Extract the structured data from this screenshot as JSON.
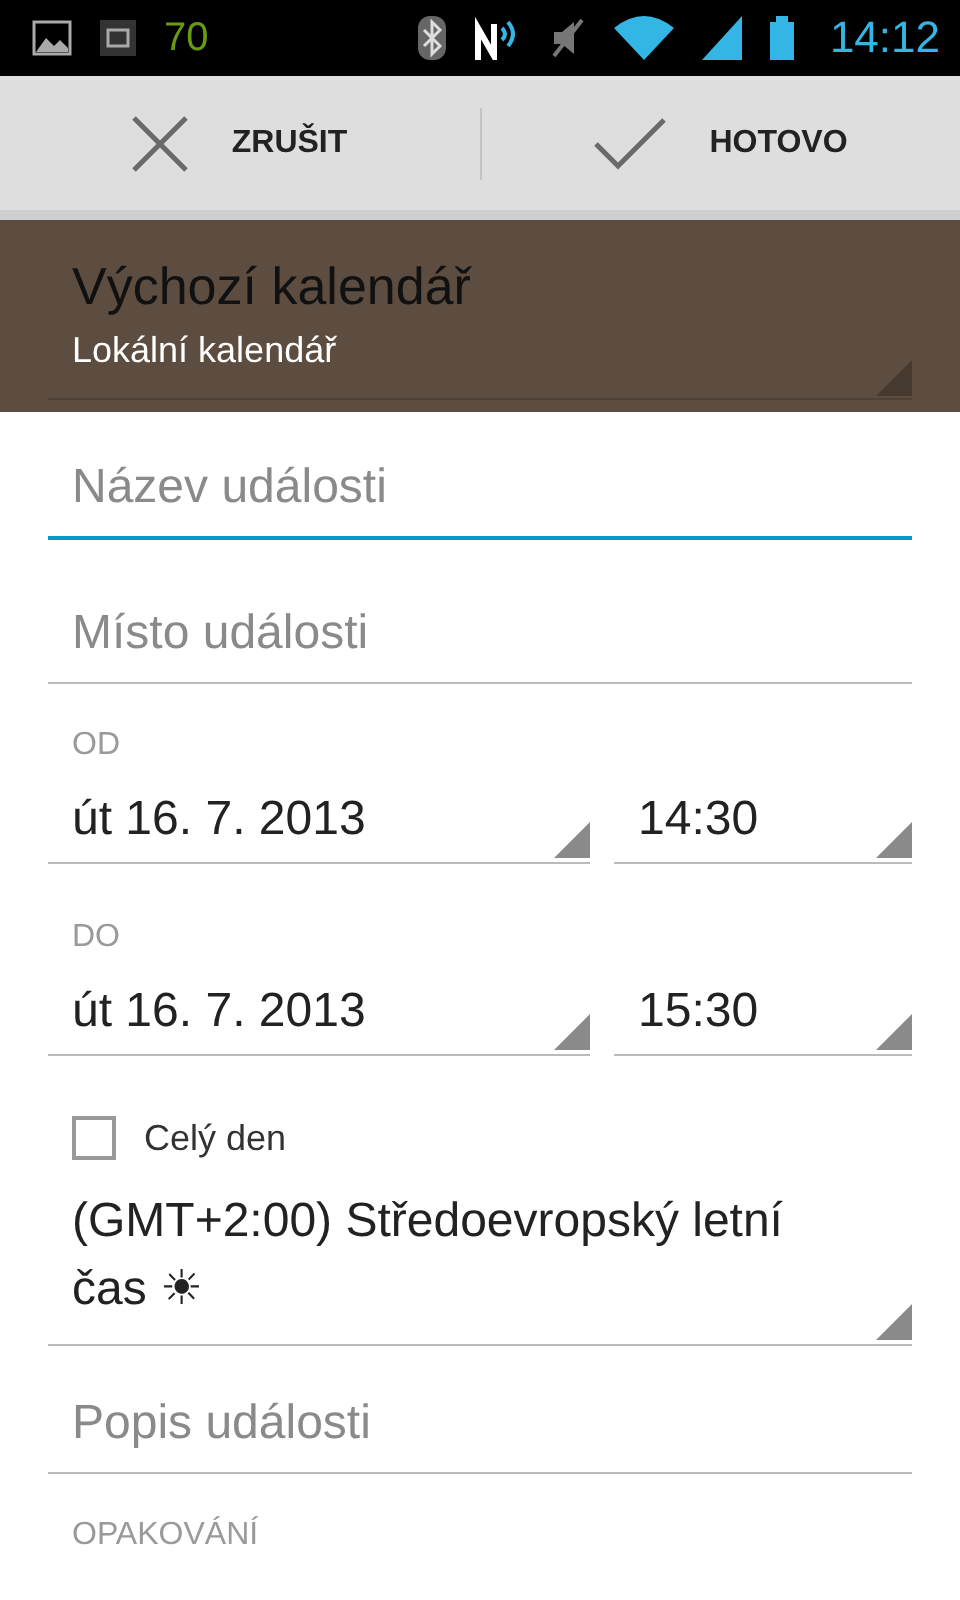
{
  "status_bar": {
    "battery_text": "70",
    "time": "14:12"
  },
  "action_bar": {
    "buttons": [
      {
        "kind": "cancel",
        "label": "ZRUŠIT"
      },
      {
        "kind": "done",
        "label": "HOTOVO"
      }
    ]
  },
  "calendar": {
    "title": "Výchozí kalendář",
    "account": "Lokální kalendář"
  },
  "title_field": {
    "placeholder": "Název události",
    "focused": true
  },
  "location_field": {
    "placeholder": "Místo události",
    "focused": false
  },
  "time_rows": [
    {
      "label": "OD",
      "date": "út 16. 7. 2013",
      "time": "14:30"
    },
    {
      "label": "DO",
      "date": "út 16. 7. 2013",
      "time": "15:30"
    }
  ],
  "all_day": {
    "label": "Celý den",
    "checked": false
  },
  "timezone": "(GMT+2:00) Středoevropský letní čas ☀",
  "description_field": {
    "placeholder": "Popis události",
    "focused": false
  },
  "repeat_label": "OPAKOVÁNÍ"
}
